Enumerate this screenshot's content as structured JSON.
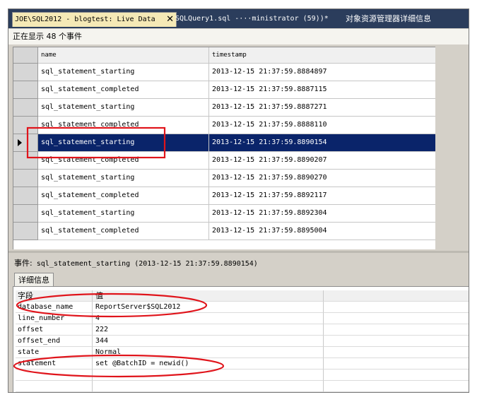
{
  "tabs": {
    "active_label": "JOE\\SQL2012 - blogtest: Live Data",
    "tab2_label": "SQLQuery1.sql -···ministrator (59))*",
    "tab3_label": "对象资源管理器详细信息",
    "close_glyph": "✕"
  },
  "status": {
    "text": "正在显示 48 个事件"
  },
  "grid": {
    "columns": [
      "name",
      "timestamp"
    ],
    "rows": [
      {
        "name": "sql_statement_starting",
        "timestamp": "2013-12-15 21:37:59.8884897"
      },
      {
        "name": "sql_statement_completed",
        "timestamp": "2013-12-15 21:37:59.8887115"
      },
      {
        "name": "sql_statement_starting",
        "timestamp": "2013-12-15 21:37:59.8887271"
      },
      {
        "name": "sql_statement_completed",
        "timestamp": "2013-12-15 21:37:59.8888110"
      },
      {
        "name": "sql_statement_starting",
        "timestamp": "2013-12-15 21:37:59.8890154",
        "selected": true
      },
      {
        "name": "sql_statement_completed",
        "timestamp": "2013-12-15 21:37:59.8890207"
      },
      {
        "name": "sql_statement_starting",
        "timestamp": "2013-12-15 21:37:59.8890270"
      },
      {
        "name": "sql_statement_completed",
        "timestamp": "2013-12-15 21:37:59.8892117"
      },
      {
        "name": "sql_statement_starting",
        "timestamp": "2013-12-15 21:37:59.8892304"
      },
      {
        "name": "sql_statement_completed",
        "timestamp": "2013-12-15 21:37:59.8895004"
      }
    ]
  },
  "event": {
    "label": "事件:",
    "text": "sql_statement_starting (2013-12-15 21:37:59.8890154)"
  },
  "details": {
    "tab_label": "详细信息",
    "col_field": "字段",
    "col_value": "值",
    "rows": [
      {
        "field": "database_name",
        "value": "ReportServer$SQL2012"
      },
      {
        "field": "line_number",
        "value": "4"
      },
      {
        "field": "offset",
        "value": "222"
      },
      {
        "field": "offset_end",
        "value": "344"
      },
      {
        "field": "state",
        "value": "Normal"
      },
      {
        "field": "statement",
        "value": "set @BatchID = newid()",
        "more": "..."
      }
    ]
  },
  "colors": {
    "tab_strip": "#2b3d5c",
    "active_tab": "#f5e9b6",
    "selected_row": "#0a246a",
    "annotation": "#e0141b"
  },
  "icons": {
    "row_indicator": "triangle-right-icon"
  }
}
